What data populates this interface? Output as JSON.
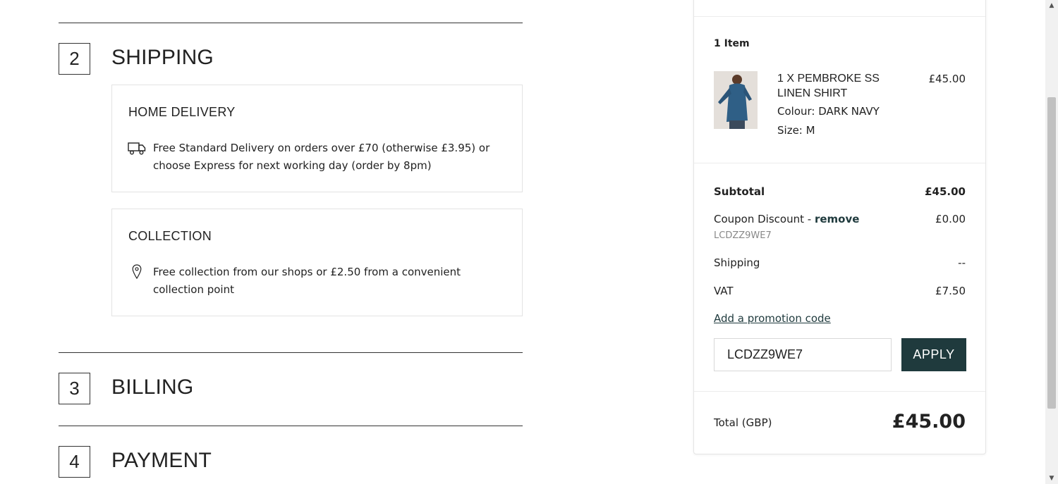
{
  "steps": [
    {
      "number": "2",
      "title": "SHIPPING"
    },
    {
      "number": "3",
      "title": "BILLING"
    },
    {
      "number": "4",
      "title": "PAYMENT"
    }
  ],
  "shipping_options": [
    {
      "title": "HOME DELIVERY",
      "icon": "truck-icon",
      "text": "Free Standard Delivery on orders over £70 (otherwise £3.95) or choose Express for next working day (order by 8pm)"
    },
    {
      "title": "COLLECTION",
      "icon": "location-pin-icon",
      "text": "Free collection from our shops or £2.50 from a convenient collection point"
    }
  ],
  "summary": {
    "item_count": "1 Item",
    "item": {
      "name": "1 X PEMBROKE SS LINEN SHIRT",
      "colour": "Colour: DARK NAVY",
      "size": "Size: M",
      "price": "£45.00"
    },
    "subtotal_label": "Subtotal",
    "subtotal_value": "£45.00",
    "coupon_label": "Coupon Discount - ",
    "coupon_remove": "remove",
    "coupon_code": "LCDZZ9WE7",
    "coupon_value": "£0.00",
    "shipping_label": "Shipping",
    "shipping_value": "--",
    "vat_label": "VAT",
    "vat_value": "£7.50",
    "promo_link": "Add a promotion code",
    "promo_input_value": "LCDZZ9WE7",
    "apply_label": "APPLY",
    "total_label": "Total (GBP)",
    "total_value": "£45.00"
  },
  "colors": {
    "accent": "#1f3a3d",
    "rule": "#333333",
    "border": "#e3e3e3"
  }
}
